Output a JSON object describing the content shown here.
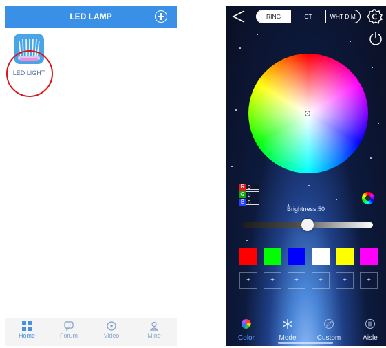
{
  "left_screen": {
    "header_title": "LED LAMP",
    "device": {
      "label": "LED LIGHT"
    },
    "nav": [
      {
        "label": "Home",
        "icon": "grid-icon",
        "active": true
      },
      {
        "label": "Forum",
        "icon": "chat-icon",
        "active": false
      },
      {
        "label": "Video",
        "icon": "play-icon",
        "active": false
      },
      {
        "label": "Mine",
        "icon": "user-icon",
        "active": false
      }
    ],
    "colors": {
      "header": "#3a90e6",
      "highlight_circle": "#d8161b"
    }
  },
  "right_screen": {
    "tabs": [
      "RING",
      "CT",
      "WHT DIM"
    ],
    "selected_tab": "RING",
    "rgb": [
      {
        "key": "R",
        "value": "0",
        "color": "#e02020"
      },
      {
        "key": "G",
        "value": "0",
        "color": "#12a412"
      },
      {
        "key": "B",
        "value": "0",
        "color": "#2a3fff"
      }
    ],
    "brightness_label": "Brightness:50",
    "brightness_value": 0.5,
    "swatches": [
      "#ff0000",
      "#00ff00",
      "#0000ff",
      "#ffffff",
      "#ffff00",
      "#ff00ff"
    ],
    "plus_buttons": [
      "+",
      "+",
      "+",
      "+",
      "+",
      "+"
    ],
    "nav": [
      {
        "label": "Color",
        "icon": "color-wheel-icon",
        "active": true
      },
      {
        "label": "Mode",
        "icon": "snowflake-icon",
        "active": false
      },
      {
        "label": "Custom",
        "icon": "compass-icon",
        "active": false
      },
      {
        "label": "Aisle",
        "icon": "aisle-icon",
        "active": false
      }
    ]
  }
}
